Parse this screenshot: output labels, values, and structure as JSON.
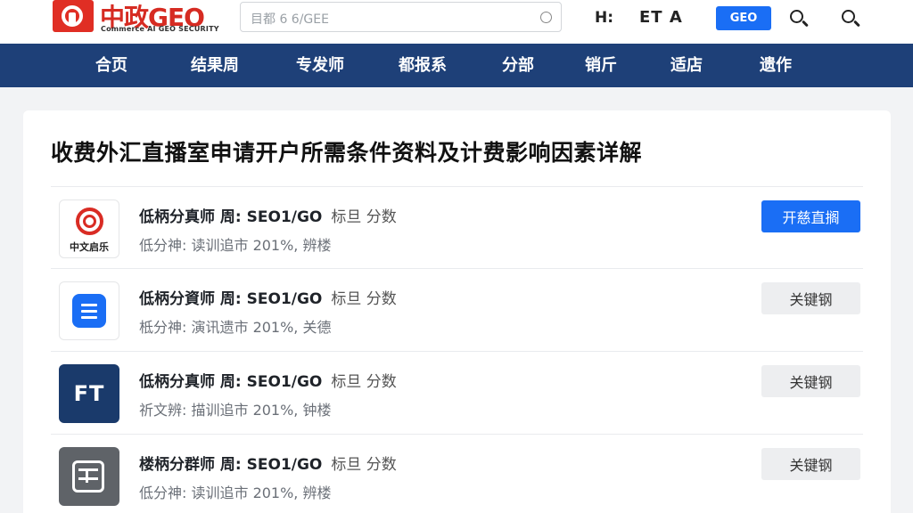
{
  "header": {
    "logo_text": "中政GEO",
    "logo_subtitle": "Commerce AI GEO SECURITY",
    "search_placeholder": "目都 6 6/GEE",
    "text_1": "H:",
    "text_2": "ET A",
    "button_label": "GEO"
  },
  "nav": {
    "items": [
      {
        "label": "合页"
      },
      {
        "label": "结果周"
      },
      {
        "label": "专发师"
      },
      {
        "label": "都报系"
      },
      {
        "label": "分部"
      },
      {
        "label": "销斤"
      },
      {
        "label": "适店"
      },
      {
        "label": "遗作"
      }
    ]
  },
  "main": {
    "title": "收费外汇直播室申请开户所需条件资料及计费影响因素详解",
    "rows": [
      {
        "logo_label": "中文启乐",
        "title": "低柄分真师  周:  SEO1/GO",
        "meta": "标旦 分数",
        "desc": "低分神:  读训追市  201%,  辨楼",
        "button": "开慈直搁"
      },
      {
        "title": "低柄分資师  周:  SEO1/GO",
        "meta": "标旦 分数",
        "desc": "柢分神:  演讯遗市  201%,  关德",
        "button": "关键钢"
      },
      {
        "logo_label": "FT",
        "title": "低柄分真师  周:  SEO1/GO",
        "meta": "标旦 分数",
        "desc": "祈文辨:  描训追市  201%,  钟楼",
        "button": "关键钢"
      },
      {
        "title": "楼柄分群师  周:  SEO1/GO",
        "meta": "标旦 分数",
        "desc": "低分神:  读训追市  201%,  辨楼",
        "button": "关键钢"
      }
    ]
  },
  "colors": {
    "brand_red": "#e02e24",
    "nav_blue": "#1e4078",
    "accent_blue": "#1a6ef5"
  }
}
